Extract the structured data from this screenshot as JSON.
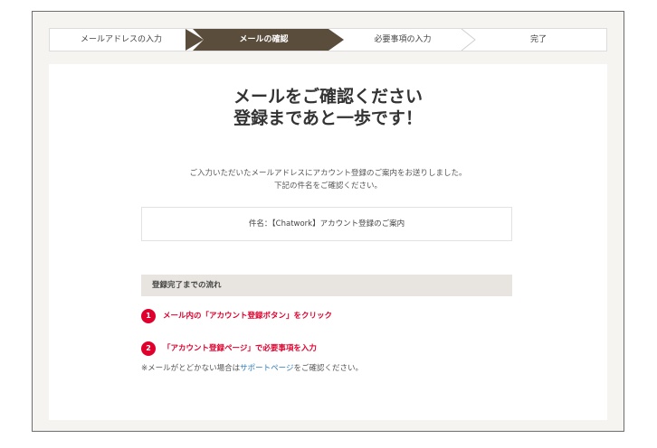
{
  "steps": [
    "メールアドレスの入力",
    "メールの確認",
    "必要事項の入力",
    "完了"
  ],
  "title_line1": "メールをご確認ください",
  "title_line2": "登録まであと一歩です！",
  "message_line1": "ご入力いただいたメールアドレスにアカウント登録のご案内をお送りしました。",
  "message_line2": "下記の件名をご確認ください。",
  "subject": "件名：【Chatwork】アカウント登録のご案内",
  "flow": {
    "heading": "登録完了までの流れ",
    "items": [
      {
        "num": "1",
        "text": "メール内の「アカウント登録ボタン」をクリック"
      },
      {
        "num": "2",
        "text": "「アカウント登録ページ」で必要事項を入力"
      }
    ]
  },
  "note": {
    "prefix": "※メールがとどかない場合は",
    "link": "サポートページ",
    "suffix": "をご確認ください。"
  },
  "colors": {
    "active_step": "#5a4d3c",
    "accent_red": "#e0002d",
    "link_blue": "#2a7ab9"
  }
}
